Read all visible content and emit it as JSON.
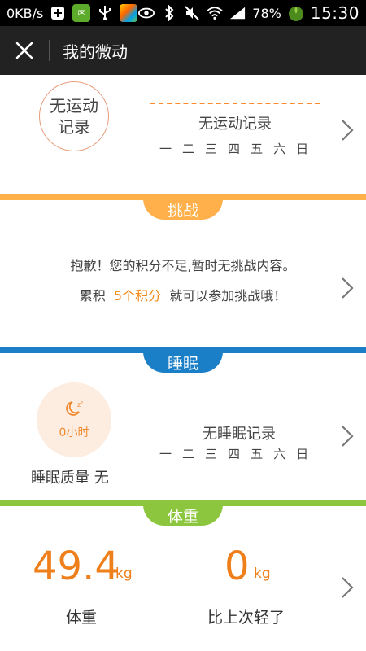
{
  "statusbar": {
    "speed": "0KB/s",
    "battery": "78%",
    "time": "15:30"
  },
  "header": {
    "title": "我的微动"
  },
  "exercise": {
    "circle_line1": "无运动",
    "circle_line2": "记录",
    "no_record": "无运动记录",
    "weekdays": [
      "一",
      "二",
      "三",
      "四",
      "五",
      "六",
      "日"
    ]
  },
  "challenge": {
    "tab_label": "挑战",
    "line1": "抱歉！您的积分不足,暂时无挑战内容。",
    "line2_prefix": "累积",
    "line2_highlight": "5个积分",
    "line2_suffix": "就可以参加挑战哦！"
  },
  "sleep": {
    "tab_label": "睡眠",
    "hours": "0小时",
    "quality": "睡眠质量 无",
    "no_record": "无睡眠记录",
    "weekdays": [
      "一",
      "二",
      "三",
      "四",
      "五",
      "六",
      "日"
    ]
  },
  "weight": {
    "tab_label": "体重",
    "value": "49.4",
    "unit": "kg",
    "label": "体重",
    "diff_value": "0",
    "diff_unit": "kg",
    "diff_label": "比上次轻了"
  },
  "colors": {
    "orange_accent": "#ffb04a",
    "blue_accent": "#1a7fc7",
    "green_accent": "#8cc63f",
    "number_orange": "#ef7f1a"
  }
}
